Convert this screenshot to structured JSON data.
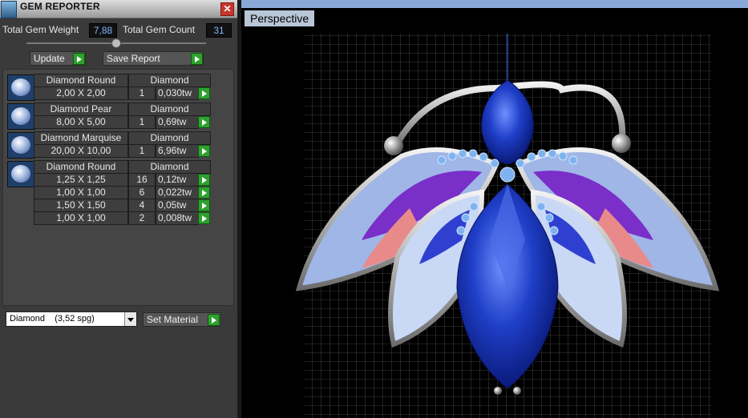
{
  "window": {
    "title": "GEM REPORTER",
    "close_glyph": "✕",
    "icon": "gem-reporter-icon"
  },
  "stats": {
    "weight_label": "Total Gem Weight",
    "weight_value": "7,88",
    "count_label": "Total Gem Count",
    "count_value": "31"
  },
  "buttons": {
    "update": "Update",
    "save_report": "Save Report",
    "set_material": "Set Material"
  },
  "gems": [
    {
      "name": "Diamond Round",
      "material": "Diamond",
      "icon": "round-gem-icon",
      "rows": [
        {
          "size": "2,00 X 2,00",
          "qty": "1",
          "tw": "0,030tw"
        }
      ]
    },
    {
      "name": "Diamond Pear",
      "material": "Diamond",
      "icon": "pear-gem-icon",
      "rows": [
        {
          "size": "8,00 X 5,00",
          "qty": "1",
          "tw": "0,69tw"
        }
      ]
    },
    {
      "name": "Diamond Marquise",
      "material": "Diamond",
      "icon": "marquise-gem-icon",
      "rows": [
        {
          "size": "20,00 X 10,00",
          "qty": "1",
          "tw": "6,96tw"
        }
      ]
    },
    {
      "name": "Diamond Round",
      "material": "Diamond",
      "icon": "round-gem-icon",
      "rows": [
        {
          "size": "1,25 X 1,25",
          "qty": "16",
          "tw": "0,12tw"
        },
        {
          "size": "1,00 X 1,00",
          "qty": "6",
          "tw": "0,022tw"
        },
        {
          "size": "1,50 X 1,50",
          "qty": "4",
          "tw": "0,05tw"
        },
        {
          "size": "1,00 X 1,00",
          "qty": "2",
          "tw": "0,008tw"
        }
      ]
    }
  ],
  "material_select": {
    "selected": "Diamond    (3,52 spg)"
  },
  "viewport": {
    "tab_label": "Perspective",
    "model": "butterfly-pendant-render"
  },
  "colors": {
    "panel_bg": "#3a3a3a",
    "value_text": "#7fb6ff",
    "go_button": "#2fa12f",
    "viewport_tab": "#b9c6d8"
  }
}
